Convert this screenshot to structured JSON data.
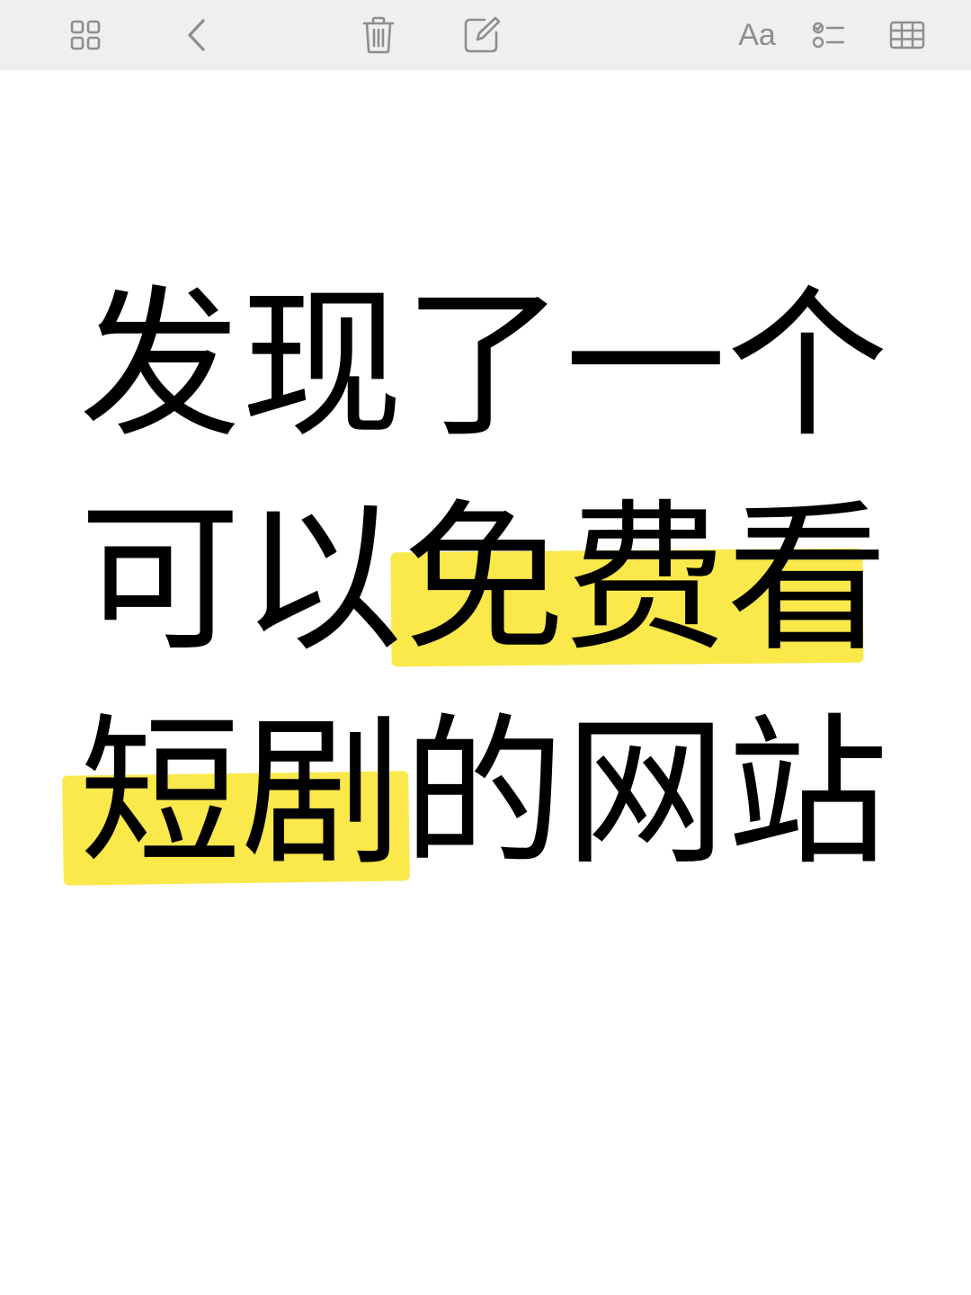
{
  "toolbar": {
    "left_items": [
      {
        "icon": "grid-view-icon"
      },
      {
        "icon": "chevron-left-icon"
      }
    ],
    "center_items": [
      {
        "icon": "trash-icon"
      },
      {
        "icon": "compose-icon"
      }
    ],
    "right_items": [
      {
        "icon": "text-format-icon",
        "label": "Aa"
      },
      {
        "icon": "checklist-icon"
      },
      {
        "icon": "table-icon"
      }
    ],
    "icon_color": "#8e8e8e",
    "background": "#efefef"
  },
  "note": {
    "lines": [
      [
        {
          "text": "发现了一个",
          "highlight": false
        }
      ],
      [
        {
          "text": "可以",
          "highlight": false
        },
        {
          "text": "免费看",
          "highlight": true
        }
      ],
      [
        {
          "text": "短剧",
          "highlight": true
        },
        {
          "text": "的网站",
          "highlight": false
        }
      ]
    ],
    "highlight_color": "#fbe84a",
    "text_color": "#000000"
  }
}
